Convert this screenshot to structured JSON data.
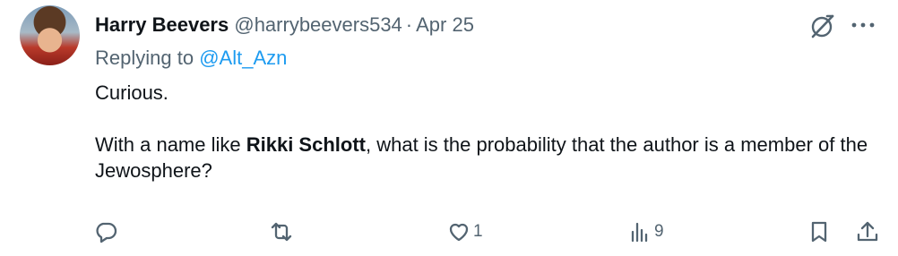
{
  "tweet": {
    "display_name": "Harry Beevers",
    "handle": "@harrybeevers534",
    "separator": "·",
    "date": "Apr 25",
    "replying_prefix": "Replying to",
    "replying_to": "@Alt_Azn",
    "body": {
      "line1": "Curious.",
      "line2_pre": "With a name like ",
      "line2_bold": "Rikki Schlott",
      "line2_post": ", what is the probability that the author is a member of the Jewosphere?"
    }
  },
  "actions": {
    "reply_count": "",
    "retweet_count": "",
    "like_count": "1",
    "views_count": "9"
  },
  "icons": {
    "top_right": [
      "grok-icon",
      "more-icon"
    ],
    "actions": [
      "reply-icon",
      "retweet-icon",
      "like-icon",
      "views-icon",
      "bookmark-icon",
      "share-icon"
    ]
  },
  "colors": {
    "text": "#0f1419",
    "secondary": "#536471",
    "link": "#1d9bf0"
  }
}
